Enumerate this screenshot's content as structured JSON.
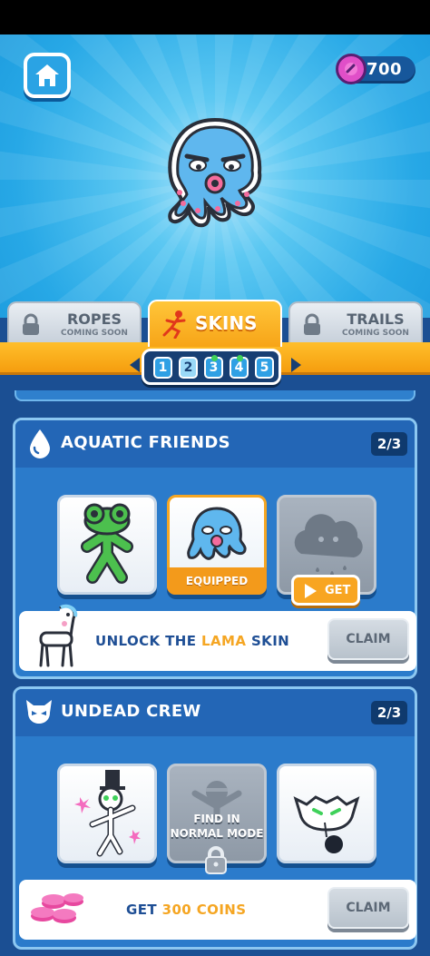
{
  "currency": {
    "gems": "700",
    "icon": "gem-icon"
  },
  "tabs": {
    "ropes": {
      "label": "ROPES",
      "sub": "COMING SOON"
    },
    "skins": {
      "label": "SKINS"
    },
    "trails": {
      "label": "TRAILS",
      "sub": "COMING SOON"
    }
  },
  "pages": [
    "1",
    "2",
    "3",
    "4",
    "5"
  ],
  "active_page": "2",
  "colors": {
    "accent": "#f5a623",
    "panel": "#2b7bcb",
    "header": "#2366b6"
  },
  "sets": [
    {
      "title": "AQUATIC FRIENDS",
      "count": "2/3",
      "equipped_label": "EQUIPPED",
      "get_label": "GET",
      "reward": {
        "prefix": "UNLOCK THE ",
        "highlight": "LAMA",
        "suffix": " SKIN"
      },
      "claim": "CLAIM"
    },
    {
      "title": "UNDEAD CREW",
      "count": "2/3",
      "locked_text": [
        "FIND IN",
        "NORMAL MODE"
      ],
      "reward": {
        "prefix": "GET ",
        "highlight": "300 COINS",
        "suffix": ""
      },
      "claim": "CLAIM"
    }
  ]
}
